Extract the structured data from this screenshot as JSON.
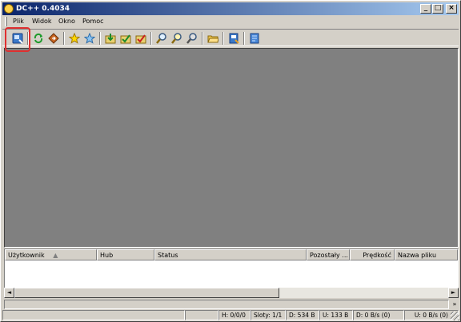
{
  "window": {
    "title": "DC++ 0.4034"
  },
  "titlebar_buttons": {
    "minimize": "_",
    "maximize": "□",
    "close": "×"
  },
  "menu": [
    "Plik",
    "Widok",
    "Okno",
    "Pomoc"
  ],
  "toolbar": {
    "buttons": [
      "connect-icon",
      "reconnect-icon",
      "follow-redirect-icon",
      "favorite-hubs-icon",
      "favorite-users-icon",
      "download-queue-icon",
      "finished-downloads-icon",
      "finished-uploads-icon",
      "search-icon",
      "adl-search-icon",
      "search-spy-icon",
      "open-file-list-icon",
      "settings-icon",
      "notepad-icon"
    ]
  },
  "transfers": {
    "columns": [
      "Użytkownik",
      "Hub",
      "Status",
      "Pozostały ...",
      "Prędkość",
      "Nazwa pliku"
    ],
    "sort_indicator": "▲"
  },
  "scroll": {
    "left": "◄",
    "right": "►"
  },
  "chevron": "»",
  "status": {
    "hubs": "H: 0/0/0",
    "slots": "Sloty: 1/1",
    "downloaded": "D: 534 B",
    "uploaded": "U: 133 B",
    "down_rate": "D: 0 B/s (0)",
    "up_rate": "U: 0 B/s (0)"
  }
}
